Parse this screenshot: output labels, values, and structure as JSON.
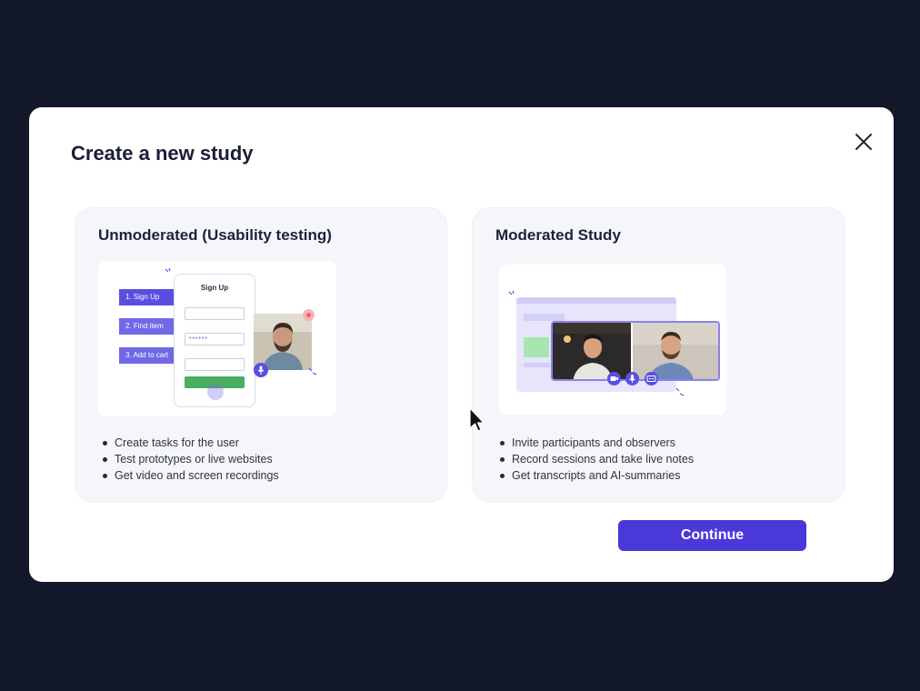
{
  "modal": {
    "title": "Create a new study",
    "close_icon": "close-icon",
    "continue_label": "Continue"
  },
  "cards": [
    {
      "title": "Unmoderated (Usability testing)",
      "illustration": {
        "tasks": [
          "1. Sign Up",
          "2. Find item",
          "3. Add to cart"
        ],
        "form_title": "Sign Up",
        "password_mask": "••••••"
      },
      "bullets": [
        "Create tasks for the user",
        "Test prototypes or live websites",
        "Get video and screen recordings"
      ]
    },
    {
      "title": "Moderated Study",
      "bullets": [
        "Invite participants and observers",
        "Record sessions and take live notes",
        "Get transcripts and AI-summaries"
      ]
    }
  ],
  "colors": {
    "background": "#121829",
    "accent": "#4b38d8",
    "card_bg": "#f5f6fa"
  }
}
